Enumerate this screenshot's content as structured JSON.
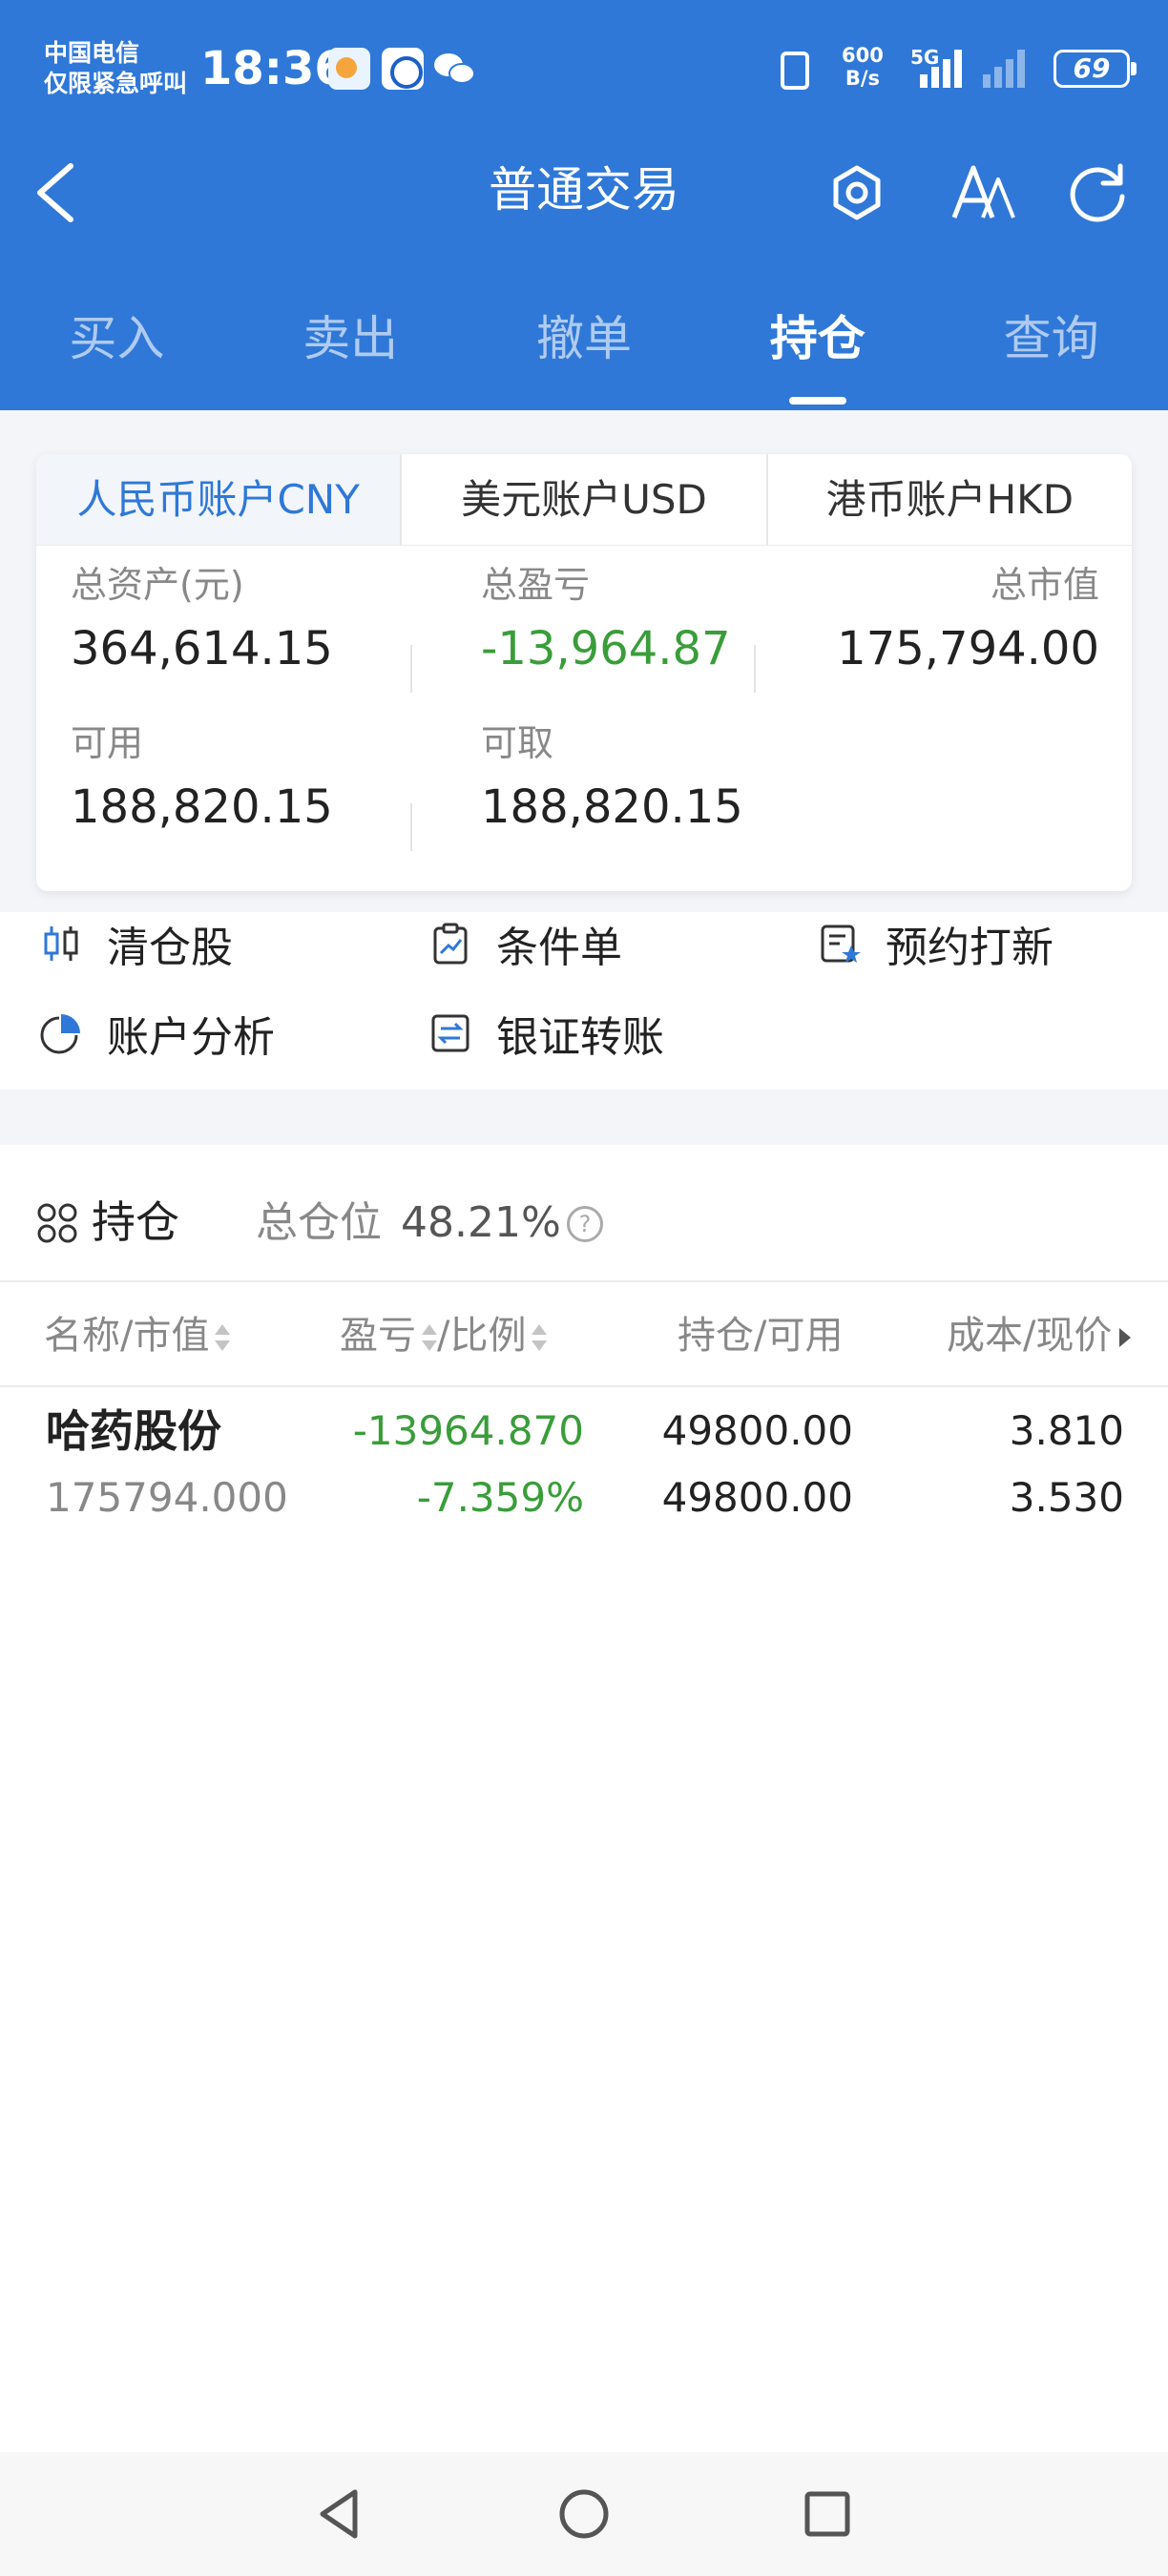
{
  "status_bar": {
    "carrier_line1": "中国电信",
    "carrier_line2": "仅限紧急呼叫",
    "time": "18:36",
    "net_speed_value": "600",
    "net_speed_unit": "B/s",
    "network_type": "5G",
    "battery": "69"
  },
  "header": {
    "title": "普通交易",
    "back_icon": "chevron-left-icon",
    "settings_icon": "hexagon-settings-icon",
    "font_icon": "font-size-icon",
    "refresh_icon": "refresh-icon"
  },
  "tabs": [
    {
      "label": "买入",
      "active": false
    },
    {
      "label": "卖出",
      "active": false
    },
    {
      "label": "撤单",
      "active": false
    },
    {
      "label": "持仓",
      "active": true
    },
    {
      "label": "查询",
      "active": false
    }
  ],
  "account": {
    "tabs": [
      {
        "label": "人民币账户CNY",
        "active": true
      },
      {
        "label": "美元账户USD",
        "active": false
      },
      {
        "label": "港币账户HKD",
        "active": false
      }
    ],
    "total_assets_label": "总资产(元)",
    "total_assets": "364,614.15",
    "total_pnl_label": "总盈亏",
    "total_pnl": "-13,964.87",
    "market_value_label": "总市值",
    "market_value": "175,794.00",
    "available_label": "可用",
    "available": "188,820.15",
    "withdrawable_label": "可取",
    "withdrawable": "188,820.15"
  },
  "actions": [
    {
      "label": "清仓股",
      "icon": "candlestick-icon"
    },
    {
      "label": "条件单",
      "icon": "clipboard-chart-icon"
    },
    {
      "label": "预约打新",
      "icon": "reserve-star-icon"
    },
    {
      "label": "账户分析",
      "icon": "pie-chart-icon"
    },
    {
      "label": "银证转账",
      "icon": "transfer-icon"
    }
  ],
  "holdings": {
    "title": "持仓",
    "position_label": "总仓位",
    "position_value": "48.21%",
    "help": "?",
    "columns": [
      "名称/市值",
      "盈亏",
      "/比例",
      "持仓/可用",
      "成本/现价"
    ],
    "rows": [
      {
        "name": "哈药股份",
        "market_value": "175794.000",
        "pnl": "-13964.870",
        "pnl_ratio": "-7.359%",
        "position": "49800.00",
        "available": "49800.00",
        "cost": "3.810",
        "price": "3.530"
      }
    ]
  },
  "colors": {
    "brand_blue": "#2f78d8",
    "loss_green": "#3a9d3a"
  }
}
